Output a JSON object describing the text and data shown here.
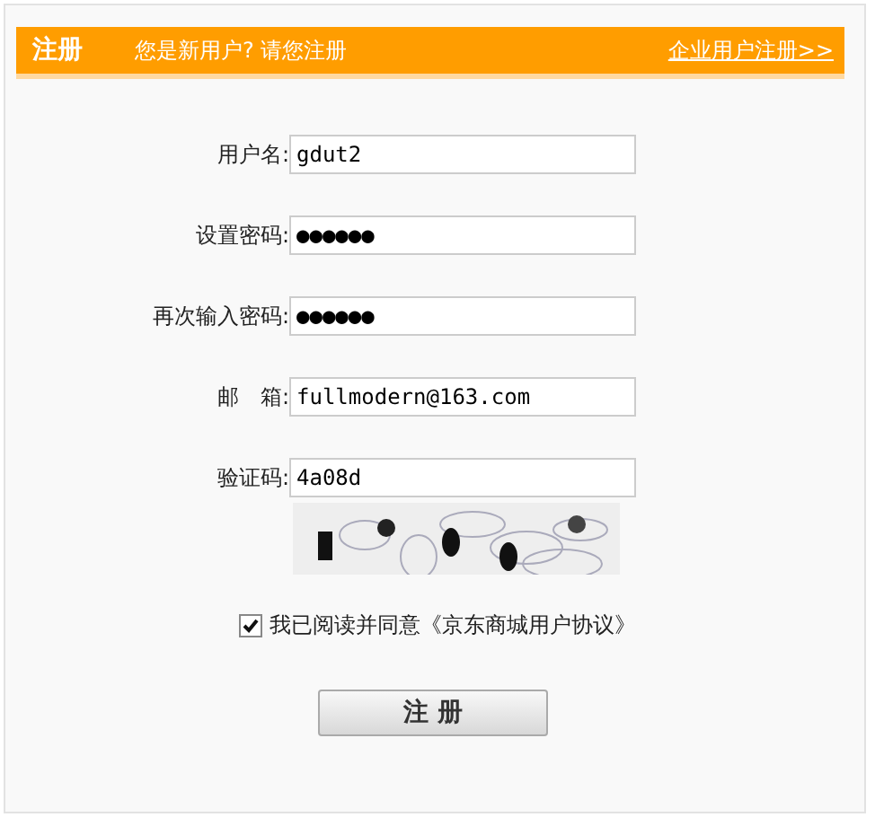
{
  "header": {
    "title": "注册",
    "subtitle": "您是新用户? 请您注册",
    "link": "企业用户注册>>"
  },
  "fields": [
    {
      "label": "用户名:",
      "value": "gdut2"
    },
    {
      "label": "设置密码:",
      "value": "●●●●●●"
    },
    {
      "label": "再次输入密码:",
      "value": "●●●●●●"
    },
    {
      "label": "邮　箱:",
      "value": "fullmodern@163.com"
    },
    {
      "label": "验证码:",
      "value": "4a08d"
    }
  ],
  "agreement": {
    "checked": true,
    "text": "我已阅读并同意《京东商城用户协议》"
  },
  "submit": "注 册"
}
